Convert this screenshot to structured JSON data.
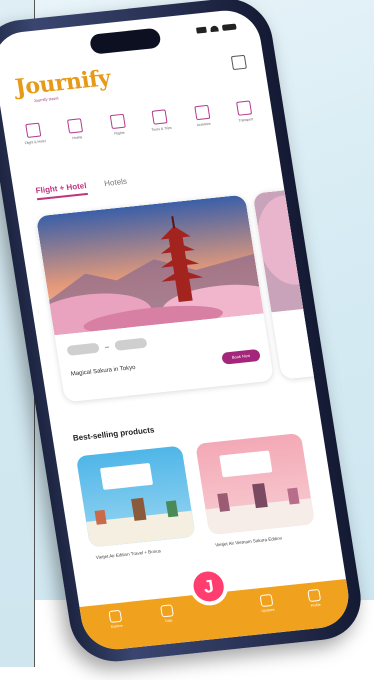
{
  "app": {
    "logo_text": "Journify",
    "logo_tagline": "Journify travel"
  },
  "categories": [
    {
      "label": "Flight & Hotel",
      "icon": "suitcase-icon"
    },
    {
      "label": "Hotels",
      "icon": "hotel-icon"
    },
    {
      "label": "Flights",
      "icon": "plane-icon"
    },
    {
      "label": "Tours & Trips",
      "icon": "tour-icon"
    },
    {
      "label": "Activities",
      "icon": "ticket-icon"
    },
    {
      "label": "Transport",
      "icon": "car-icon"
    }
  ],
  "tabs": [
    {
      "label": "Flight + Hotel",
      "active": true
    },
    {
      "label": "Hotels",
      "active": false
    }
  ],
  "featured": {
    "title": "Magical Sakura in Tokyo",
    "cta": "Book Now"
  },
  "section_title": "Best-selling products",
  "products": [
    {
      "name": "Vietjet Air Edition Travel + Bonus"
    },
    {
      "name": "Vietjet Air Vietnam Sakura Edition"
    }
  ],
  "nav": [
    {
      "label": "Explore",
      "icon": "compass-icon"
    },
    {
      "label": "Trips",
      "icon": "bag-icon"
    },
    {
      "label": "Updates",
      "icon": "bell-icon"
    },
    {
      "label": "Profile",
      "icon": "user-icon"
    }
  ],
  "colors": {
    "brand_orange": "#f0a21e",
    "brand_purple": "#a3267a",
    "fab_pink": "#ff3d6e"
  }
}
